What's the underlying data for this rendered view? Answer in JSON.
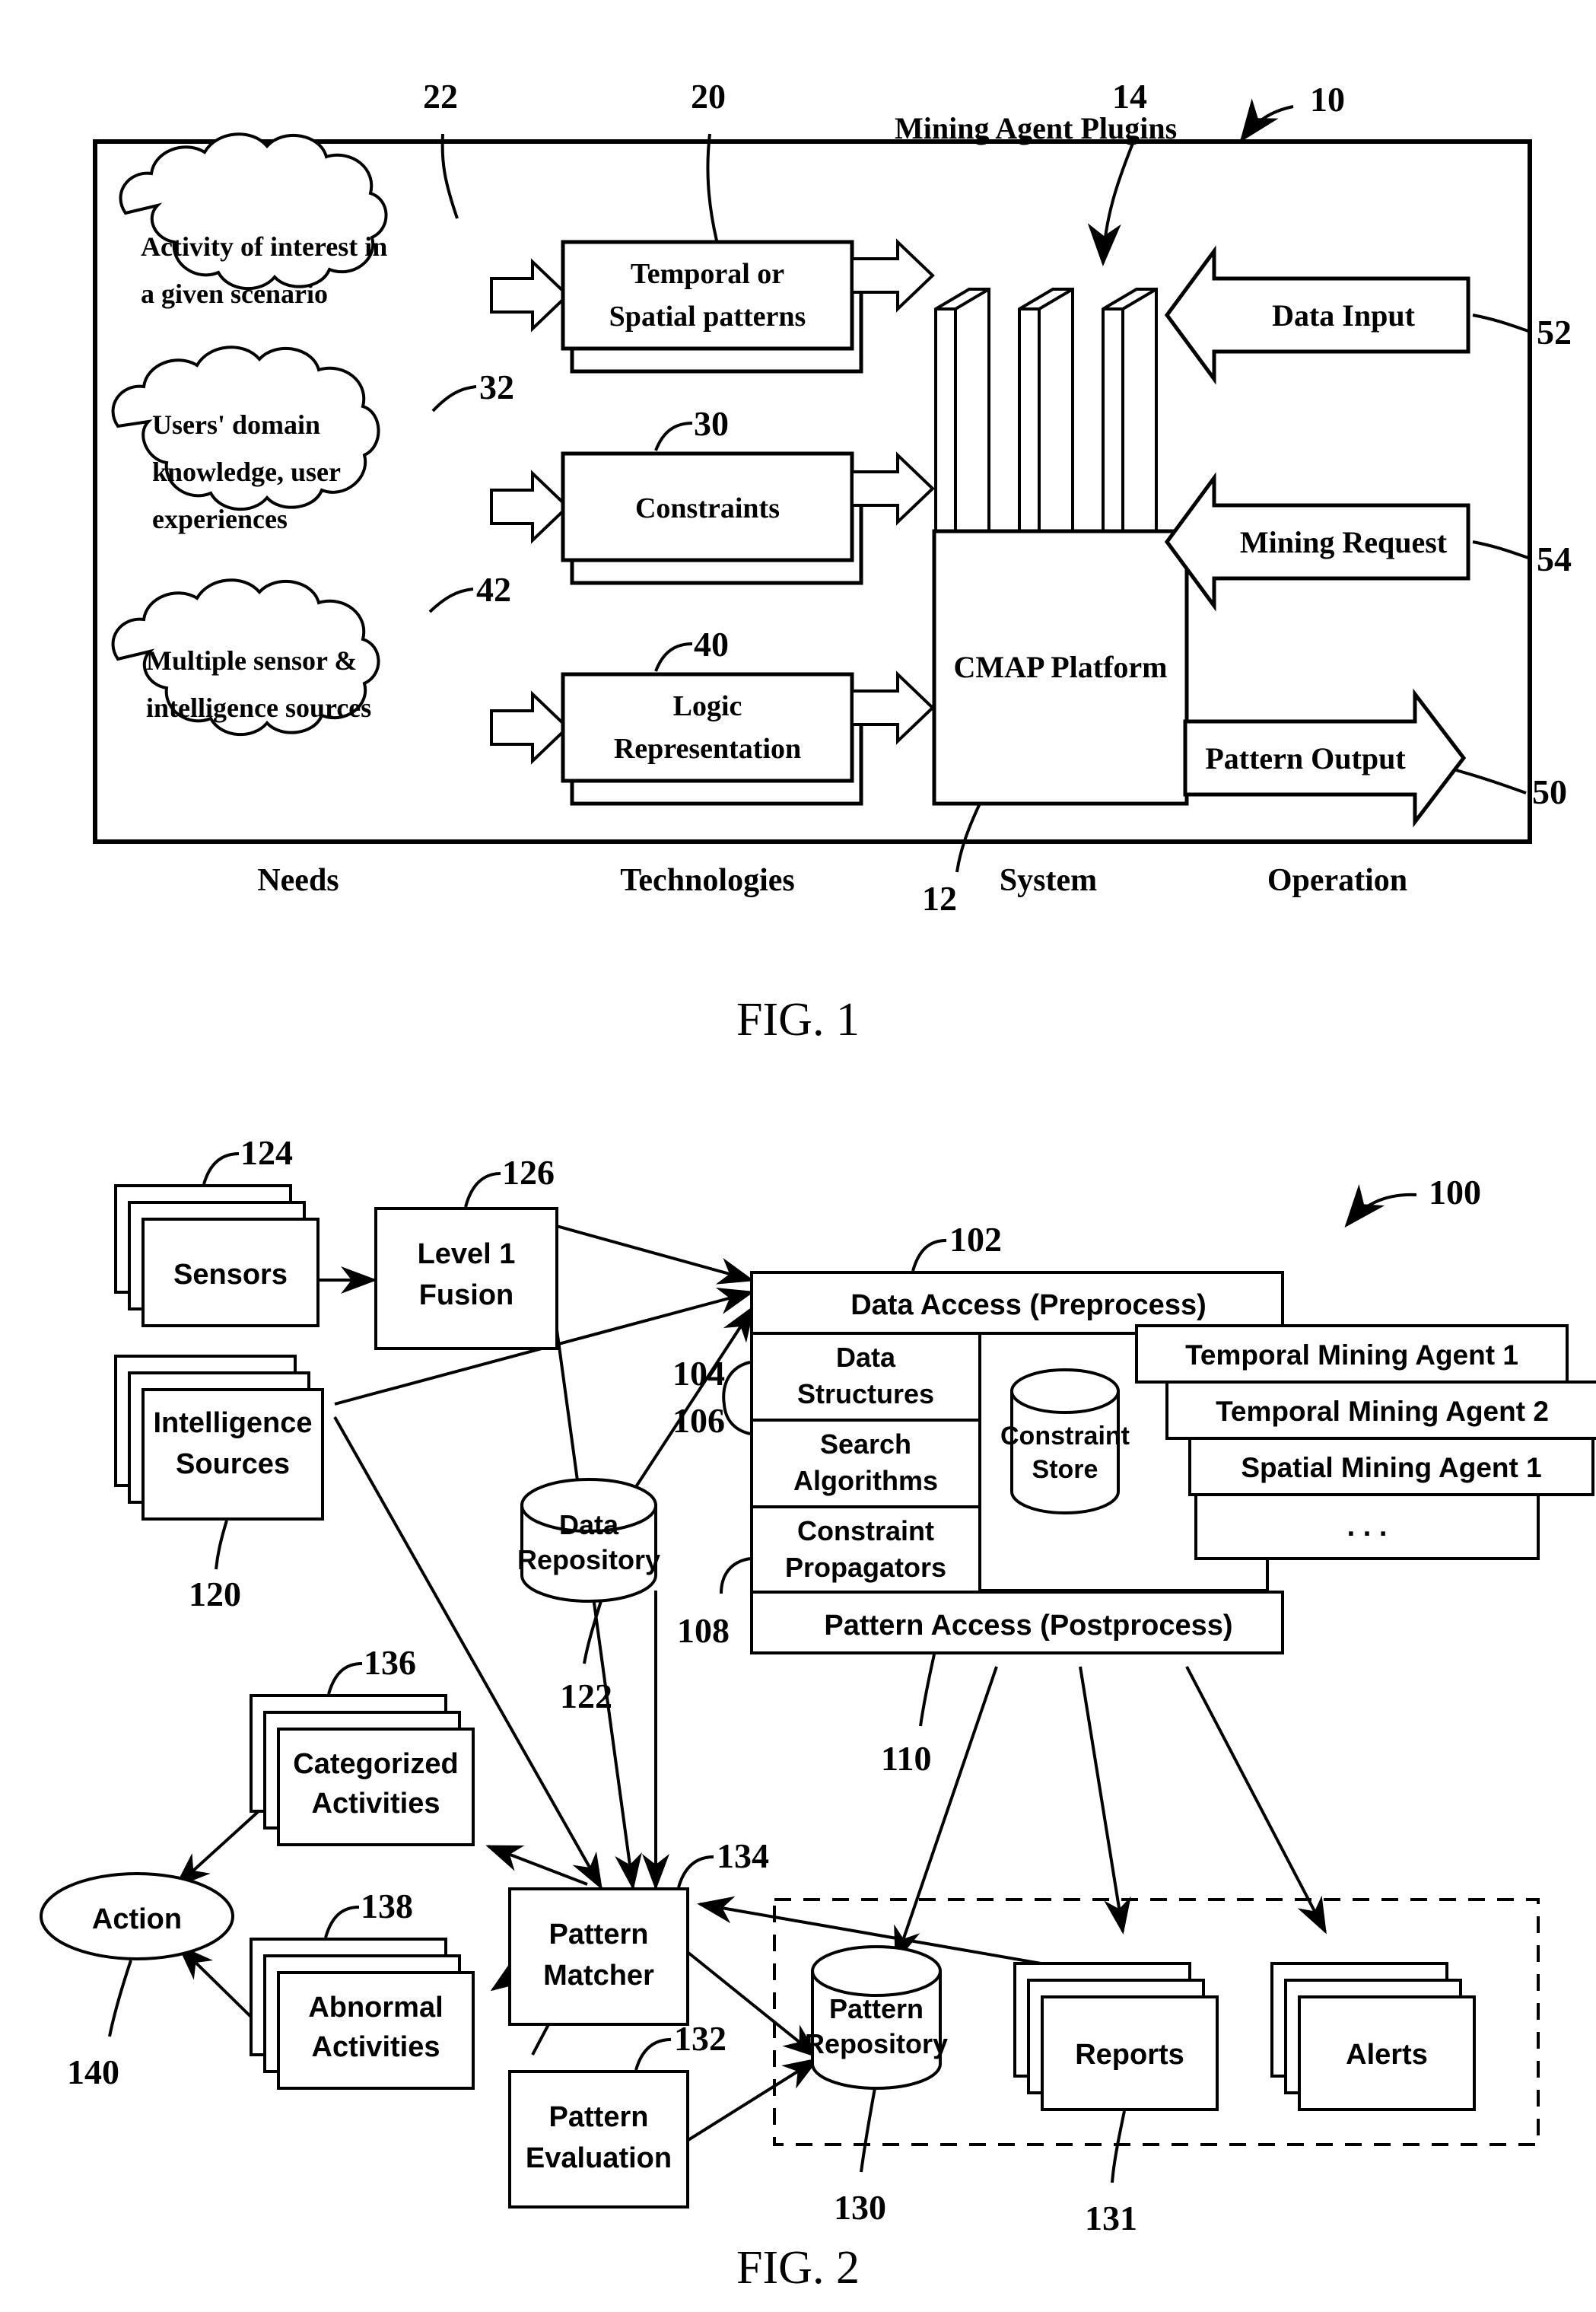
{
  "figures": [
    {
      "id": "fig1",
      "caption": "FIG. 1",
      "system_ref": "10",
      "clouds": [
        {
          "ref": "22",
          "lines": [
            "Activity of interest in",
            "a given scenario"
          ]
        },
        {
          "ref": "32",
          "lines": [
            "Users' domain",
            "knowledge, user",
            "experiences"
          ]
        },
        {
          "ref": "42",
          "lines": [
            "Multiple sensor &",
            "intelligence sources"
          ]
        }
      ],
      "tech_boxes": [
        {
          "ref": "20",
          "lines": [
            "Temporal or",
            "Spatial patterns"
          ]
        },
        {
          "ref": "30",
          "lines": [
            "Constraints"
          ]
        },
        {
          "ref": "40",
          "lines": [
            "Logic",
            "Representation"
          ]
        }
      ],
      "plugins_label": "Mining Agent Plugins",
      "plugins_ref": "14",
      "platform_label": "CMAP Platform",
      "platform_ref": "12",
      "io_arrows": [
        {
          "ref": "52",
          "label": "Data Input",
          "direction": "left"
        },
        {
          "ref": "54",
          "label": "Mining Request",
          "direction": "left"
        },
        {
          "ref": "50",
          "label": "Pattern Output",
          "direction": "right"
        }
      ],
      "column_labels": [
        "Needs",
        "Technologies",
        "System",
        "Operation"
      ]
    },
    {
      "id": "fig2",
      "caption": "FIG. 2",
      "system_ref": "100",
      "stacked_boxes": [
        {
          "ref": "124",
          "lines": [
            "Sensors"
          ]
        },
        {
          "ref": "120",
          "lines": [
            "Intelligence",
            "Sources"
          ]
        },
        {
          "ref": "136",
          "lines": [
            "Categorized",
            "Activities"
          ]
        },
        {
          "ref": "138",
          "lines": [
            "Abnormal",
            "Activities"
          ]
        },
        {
          "ref": "131",
          "lines": [
            "Reports"
          ]
        },
        {
          "ref": "",
          "lines": [
            "Alerts"
          ]
        }
      ],
      "plain_boxes": [
        {
          "ref": "126",
          "lines": [
            "Level 1",
            "Fusion"
          ]
        },
        {
          "ref": "134",
          "lines": [
            "Pattern",
            "Matcher"
          ]
        },
        {
          "ref": "132",
          "lines": [
            "Pattern",
            "Evaluation"
          ]
        }
      ],
      "cylinders": [
        {
          "ref": "122",
          "lines": [
            "Data",
            "Repository"
          ]
        },
        {
          "ref": "",
          "lines": [
            "Constraint",
            "Store"
          ]
        },
        {
          "ref": "130",
          "lines": [
            "Pattern",
            "Repository"
          ]
        }
      ],
      "platform_rows": [
        {
          "ref": "102",
          "label": "Data Access (Preprocess)"
        },
        {
          "ref": "104",
          "label": "Data Structures"
        },
        {
          "ref": "106",
          "label": "Search Algorithms"
        },
        {
          "ref": "",
          "label": "Constraint Propagators"
        },
        {
          "ref": "108",
          "label": "Pattern Access (Postprocess)"
        }
      ],
      "platform_ref_postprocess_out": "110",
      "agents": [
        "Temporal Mining Agent 1",
        "Temporal Mining Agent 2",
        "Spatial Mining Agent 1",
        ". . ."
      ],
      "action_node": {
        "ref": "140",
        "label": "Action"
      }
    }
  ]
}
